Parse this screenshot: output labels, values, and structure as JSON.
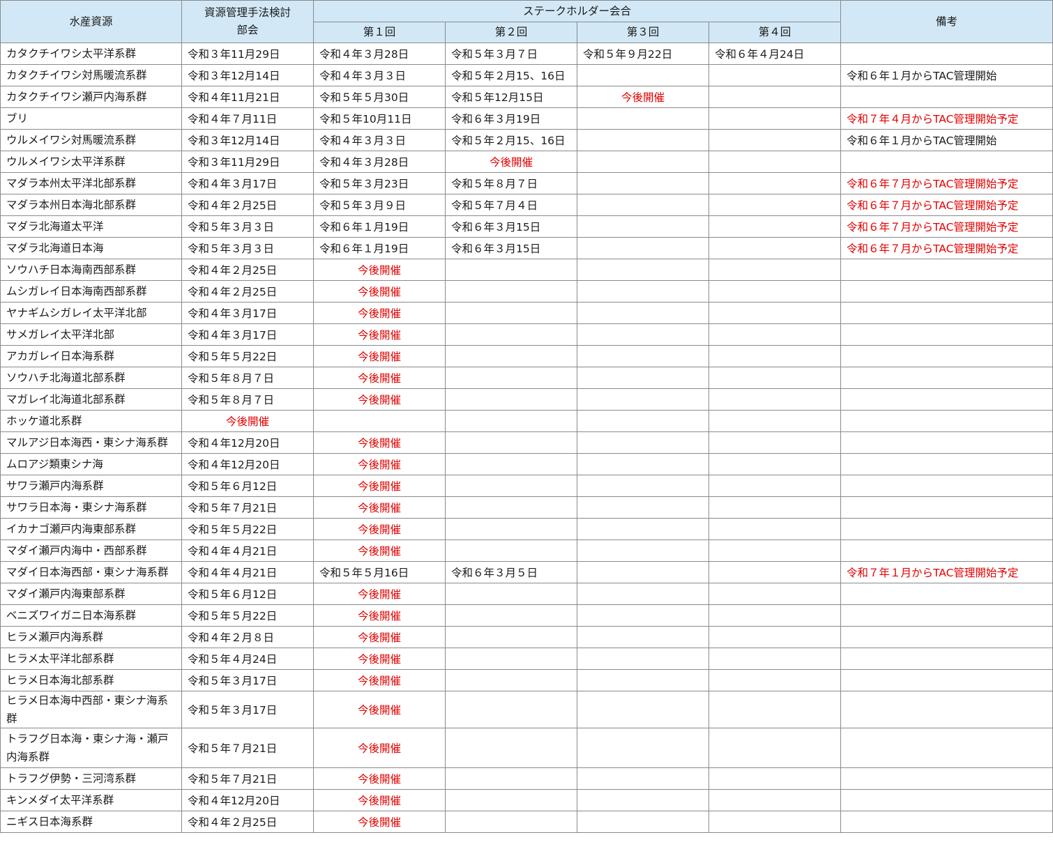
{
  "header": {
    "resource": "水産資源",
    "method": "資源管理手法検討部会",
    "stakeholder": "ステークホルダー会合",
    "r1": "第１回",
    "r2": "第２回",
    "r3": "第３回",
    "r4": "第４回",
    "notes": "備考"
  },
  "rows": [
    [
      "カタクチイワシ太平洋系群",
      "令和３年11月29日",
      "令和４年３月28日",
      "令和５年３月７日",
      "令和５年９月22日",
      "令和６年４月24日",
      ""
    ],
    [
      "カタクチイワシ対馬暖流系群",
      "令和３年12月14日",
      "令和４年３月３日",
      "令和５年２月15、16日",
      "",
      "",
      "令和６年１月からTAC管理開始"
    ],
    [
      "カタクチイワシ瀬戸内海系群",
      "令和４年11月21日",
      "令和５年５月30日",
      "令和５年12月15日",
      "今後開催",
      "",
      ""
    ],
    [
      "ブリ",
      "令和４年７月11日",
      "令和５年10月11日",
      "令和６年３月19日",
      "",
      "",
      "令和７年４月からTAC管理開始予定"
    ],
    [
      "ウルメイワシ対馬暖流系群",
      "令和３年12月14日",
      "令和４年３月３日",
      "令和５年２月15、16日",
      "",
      "",
      "令和６年１月からTAC管理開始"
    ],
    [
      "ウルメイワシ太平洋系群",
      "令和３年11月29日",
      "令和４年３月28日",
      "今後開催",
      "",
      "",
      ""
    ],
    [
      "マダラ本州太平洋北部系群",
      "令和４年３月17日",
      "令和５年３月23日",
      "令和５年８月７日",
      "",
      "",
      "令和６年７月からTAC管理開始予定"
    ],
    [
      "マダラ本州日本海北部系群",
      "令和４年２月25日",
      "令和５年３月９日",
      "令和５年７月４日",
      "",
      "",
      "令和６年７月からTAC管理開始予定"
    ],
    [
      "マダラ北海道太平洋",
      "令和５年３月３日",
      "令和６年１月19日",
      "令和６年３月15日",
      "",
      "",
      "令和６年７月からTAC管理開始予定"
    ],
    [
      "マダラ北海道日本海",
      "令和５年３月３日",
      "令和６年１月19日",
      "令和６年３月15日",
      "",
      "",
      "令和６年７月からTAC管理開始予定"
    ],
    [
      "ソウハチ日本海南西部系群",
      "令和４年２月25日",
      "今後開催",
      "",
      "",
      "",
      ""
    ],
    [
      "ムシガレイ日本海南西部系群",
      "令和４年２月25日",
      "今後開催",
      "",
      "",
      "",
      ""
    ],
    [
      "ヤナギムシガレイ太平洋北部",
      "令和４年３月17日",
      "今後開催",
      "",
      "",
      "",
      ""
    ],
    [
      "サメガレイ太平洋北部",
      "令和４年３月17日",
      "今後開催",
      "",
      "",
      "",
      ""
    ],
    [
      "アカガレイ日本海系群",
      "令和５年５月22日",
      "今後開催",
      "",
      "",
      "",
      ""
    ],
    [
      "ソウハチ北海道北部系群",
      "令和５年８月７日",
      "今後開催",
      "",
      "",
      "",
      ""
    ],
    [
      "マガレイ北海道北部系群",
      "令和５年８月７日",
      "今後開催",
      "",
      "",
      "",
      ""
    ],
    [
      "ホッケ道北系群",
      "今後開催",
      "",
      "",
      "",
      "",
      ""
    ],
    [
      "マルアジ日本海西・東シナ海系群",
      "令和４年12月20日",
      "今後開催",
      "",
      "",
      "",
      ""
    ],
    [
      "ムロアジ類東シナ海",
      "令和４年12月20日",
      "今後開催",
      "",
      "",
      "",
      ""
    ],
    [
      "サワラ瀬戸内海系群",
      "令和５年６月12日",
      "今後開催",
      "",
      "",
      "",
      ""
    ],
    [
      "サワラ日本海・東シナ海系群",
      "令和５年７月21日",
      "今後開催",
      "",
      "",
      "",
      ""
    ],
    [
      "イカナゴ瀬戸内海東部系群",
      "令和５年５月22日",
      "今後開催",
      "",
      "",
      "",
      ""
    ],
    [
      "マダイ瀬戸内海中・西部系群",
      "令和４年４月21日",
      "今後開催",
      "",
      "",
      "",
      ""
    ],
    [
      "マダイ日本海西部・東シナ海系群",
      "令和４年４月21日",
      "令和５年５月16日",
      "令和６年３月５日",
      "",
      "",
      "令和７年１月からTAC管理開始予定"
    ],
    [
      "マダイ瀬戸内海東部系群",
      "令和５年６月12日",
      "今後開催",
      "",
      "",
      "",
      ""
    ],
    [
      "ベニズワイガニ日本海系群",
      "令和５年５月22日",
      "今後開催",
      "",
      "",
      "",
      ""
    ],
    [
      "ヒラメ瀬戸内海系群",
      "令和４年２月８日",
      "今後開催",
      "",
      "",
      "",
      ""
    ],
    [
      "ヒラメ太平洋北部系群",
      "令和５年４月24日",
      "今後開催",
      "",
      "",
      "",
      ""
    ],
    [
      "ヒラメ日本海北部系群",
      "令和５年３月17日",
      "今後開催",
      "",
      "",
      "",
      ""
    ],
    [
      "ヒラメ日本海中西部・東シナ海系群",
      "令和５年３月17日",
      "今後開催",
      "",
      "",
      "",
      ""
    ],
    [
      "トラフグ日本海・東シナ海・瀬戸内海系群",
      "令和５年７月21日",
      "今後開催",
      "",
      "",
      "",
      ""
    ],
    [
      "トラフグ伊勢・三河湾系群",
      "令和５年７月21日",
      "今後開催",
      "",
      "",
      "",
      ""
    ],
    [
      "キンメダイ太平洋系群",
      "令和４年12月20日",
      "今後開催",
      "",
      "",
      "",
      ""
    ],
    [
      "ニギス日本海系群",
      "令和４年２月25日",
      "今後開催",
      "",
      "",
      "",
      ""
    ]
  ]
}
